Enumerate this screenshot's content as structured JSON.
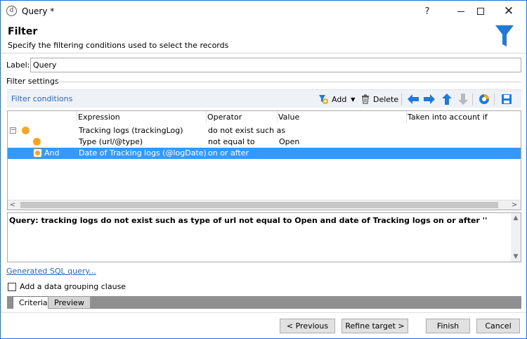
{
  "window": {
    "title": "Query *",
    "app_icon_glyph": "d"
  },
  "header": {
    "title": "Filter",
    "subtitle": "Specify the filtering conditions used to select the records",
    "icon": "funnel-icon",
    "icon_color": "#1e7bd6"
  },
  "label_field": {
    "label": "Label:",
    "value": "Query"
  },
  "filter_settings_label": "Filter settings",
  "toolbar": {
    "filter_conditions_link": "Filter conditions",
    "add_label": "Add",
    "delete_label": "Delete",
    "icons": [
      "move-left-icon",
      "move-right-icon",
      "move-up-icon",
      "move-down-icon",
      "distribution-icon",
      "save-icon"
    ],
    "arrow_color": "#1e7bd6"
  },
  "grid": {
    "columns": [
      "Expression",
      "Operator",
      "Value",
      "Taken into account if"
    ],
    "rows": [
      {
        "prefix": "",
        "expression": "Tracking logs (trackingLog)",
        "operator": "do not exist such as",
        "value": "",
        "selected": false
      },
      {
        "prefix": "",
        "expression": "Type (url/@type)",
        "operator": "not equal to",
        "value": "Open",
        "selected": false
      },
      {
        "prefix": "And",
        "expression": "Date of Tracking logs (@logDate)",
        "operator": "on or after",
        "value": "",
        "selected": true
      }
    ],
    "selection_color": "#3399ff"
  },
  "summary": "Query: tracking logs do not exist such as type of url not equal to Open and date of Tracking logs on or after ''",
  "sql_link": "Generated SQL query...",
  "grouping_checkbox": {
    "label": "Add a data grouping clause",
    "checked": false
  },
  "tabs": [
    "Criteria",
    "Preview"
  ],
  "buttons": {
    "previous": "< Previous",
    "refine": "Refine target >",
    "finish": "Finish",
    "cancel": "Cancel"
  }
}
